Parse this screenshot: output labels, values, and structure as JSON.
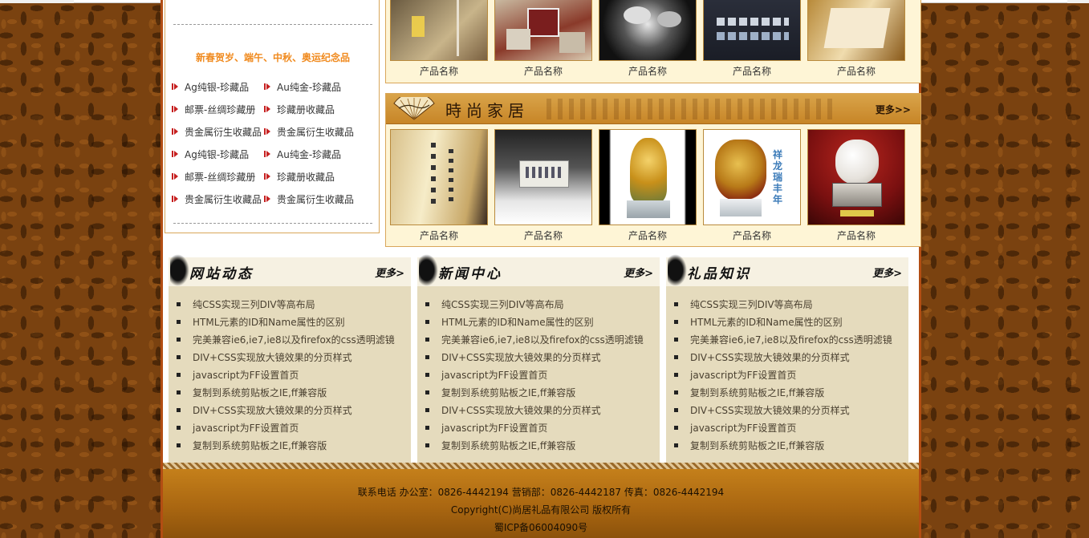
{
  "sidebar": {
    "title": "新春贺岁、端午、中秋、奥运纪念品",
    "rows": [
      [
        "Ag纯银-珍藏品",
        "Au纯金-珍藏品"
      ],
      [
        "邮票-丝绸珍藏册",
        "珍藏册收藏品"
      ],
      [
        "贵金属衍生收藏品",
        "贵金属衍生收藏品"
      ],
      [
        "Ag纯银-珍藏品",
        "Au纯金-珍藏品"
      ],
      [
        "邮票-丝绸珍藏册",
        "珍藏册收藏品"
      ],
      [
        "贵金属衍生收藏品",
        "贵金属衍生收藏品"
      ]
    ]
  },
  "products_top": {
    "captions": [
      "产品名称",
      "产品名称",
      "产品名称",
      "产品名称",
      "产品名称"
    ]
  },
  "products_fashion": {
    "title": "時尚家居",
    "more": "更多>>",
    "captions": [
      "产品名称",
      "产品名称",
      "产品名称",
      "产品名称",
      "产品名称"
    ],
    "dragon_text": "祥龙瑞丰年"
  },
  "news_items": [
    "纯CSS实现三列DIV等高布局",
    "HTML元素的ID和Name属性的区别",
    "完美兼容ie6,ie7,ie8以及firefox的css透明滤镜",
    "DIV+CSS实现放大镜效果的分页样式",
    "javascript为FF设置首页",
    "复制到系统剪贴板之IE,ff兼容版",
    "DIV+CSS实现放大镜效果的分页样式",
    "javascript为FF设置首页",
    "复制到系统剪贴板之IE,ff兼容版"
  ],
  "news_columns": [
    {
      "title": "网站动态",
      "more": "更多>"
    },
    {
      "title": "新闻中心",
      "more": "更多>"
    },
    {
      "title": "礼品知识",
      "more": "更多>"
    }
  ],
  "footer": {
    "contact": "联系电话 办公室：0826-4442194 营销部：0826-4442187 传真：0826-4442194",
    "copyright": "Copyright(C)尚居礼品有限公司 版权所有",
    "icp": "蜀ICP备06004090号"
  },
  "colors": {
    "page_bg": "#7a4210",
    "frame": "#b24d13",
    "accent_orange": "#f08a1e",
    "panel_bg": "#fef5d6",
    "news_bg": "#e5dbbd"
  }
}
